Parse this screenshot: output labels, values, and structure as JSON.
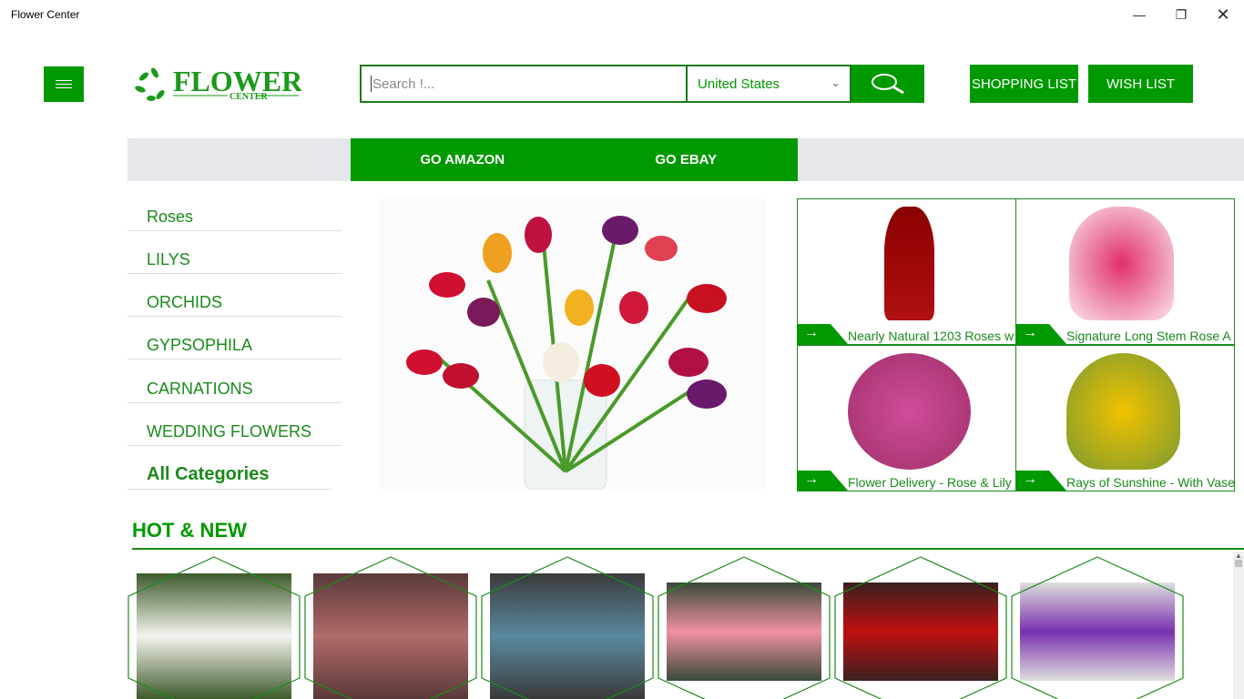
{
  "window": {
    "title": "Flower Center",
    "controls": [
      "minimize",
      "restore",
      "close"
    ]
  },
  "header": {
    "logo_text": "FLOWER",
    "logo_sub": "CENTER",
    "search_placeholder": "Search !...",
    "country": "United States",
    "shopping_list": "SHOPPING LIST",
    "wish_list": "WISH LIST"
  },
  "tabs": [
    "GO AMAZON",
    "GO EBAY"
  ],
  "categories": [
    "Roses",
    "LILYS",
    "ORCHIDS",
    "GYPSOPHILA",
    "CARNATIONS",
    "WEDDING FLOWERS",
    "All Categories"
  ],
  "featured": [
    {
      "name": "Nearly Natural 1203 Roses w",
      "colors": [
        "#8b0000",
        "#b01010"
      ]
    },
    {
      "name": "Signature Long Stem Rose A",
      "colors": [
        "#e0306a",
        "#fbe6ee"
      ]
    },
    {
      "name": "Flower Delivery - Rose & Lily",
      "colors": [
        "#d04c9a",
        "#a0306a"
      ]
    },
    {
      "name": "Rays of Sunshine - With Vase",
      "colors": [
        "#f2c200",
        "#7a9a30"
      ]
    }
  ],
  "hot_new": {
    "title": "HOT & NEW",
    "items": [
      {
        "colors": [
          "#f4f4ee",
          "#3e5a2c"
        ]
      },
      {
        "colors": [
          "#b06a6a",
          "#5a3a3a"
        ]
      },
      {
        "colors": [
          "#5a8aa0",
          "#3a3a3a"
        ]
      },
      {
        "colors": [
          "#f090a0",
          "#3a4a3a"
        ]
      },
      {
        "colors": [
          "#c01010",
          "#3a2020"
        ]
      },
      {
        "colors": [
          "#7a30b0",
          "#dedede"
        ]
      }
    ]
  },
  "accent": "#009900"
}
